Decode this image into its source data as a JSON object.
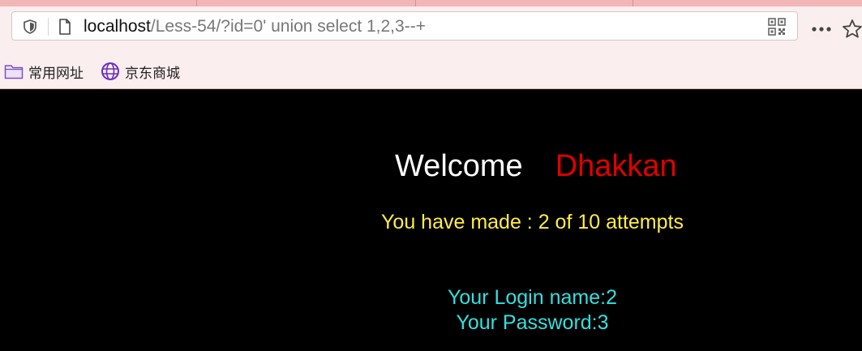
{
  "browser": {
    "url_host": "localhost",
    "url_path": "/Less-54/?id=0' union select 1,2,3--+"
  },
  "bookmarks": [
    {
      "label": "常用网址",
      "icon": "folder-icon"
    },
    {
      "label": "京东商城",
      "icon": "globe-icon"
    }
  ],
  "page": {
    "welcome": "Welcome",
    "user": "Dhakkan",
    "attempts": "You have made : 2 of 10 attempts",
    "login_name": "Your Login name:2",
    "password": "Your Password:3"
  },
  "colors": {
    "welcome": "#ffffff",
    "user": "#e00000",
    "attempts": "#ffee44",
    "result": "#33e0e0",
    "background": "#000000"
  }
}
